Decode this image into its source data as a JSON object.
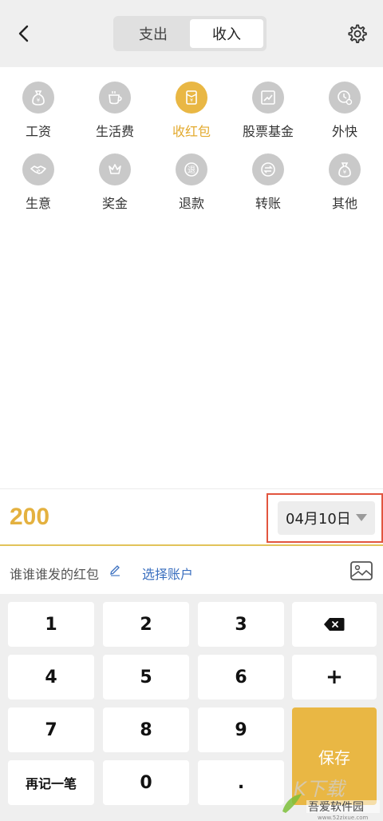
{
  "header": {
    "back_icon": "chevron-left-icon",
    "tabs": [
      {
        "label": "支出",
        "active": false
      },
      {
        "label": "收入",
        "active": true
      }
    ],
    "settings_icon": "gear-icon"
  },
  "categories": [
    {
      "label": "工资",
      "icon": "money-bag-icon",
      "active": false
    },
    {
      "label": "生活费",
      "icon": "cup-icon",
      "active": false
    },
    {
      "label": "收红包",
      "icon": "red-envelope-icon",
      "active": true
    },
    {
      "label": "股票基金",
      "icon": "stock-chart-icon",
      "active": false
    },
    {
      "label": "外快",
      "icon": "clock-coin-icon",
      "active": false
    },
    {
      "label": "生意",
      "icon": "handshake-icon",
      "active": false
    },
    {
      "label": "奖金",
      "icon": "crown-icon",
      "active": false
    },
    {
      "label": "退款",
      "icon": "refund-icon",
      "active": false
    },
    {
      "label": "转账",
      "icon": "transfer-icon",
      "active": false
    },
    {
      "label": "其他",
      "icon": "money-bag-icon",
      "active": false
    }
  ],
  "amount": {
    "value": "200",
    "date": "04月10日"
  },
  "note": {
    "text": "谁谁谁发的红包",
    "account_link": "选择账户"
  },
  "keypad": {
    "k1": "1",
    "k2": "2",
    "k3": "3",
    "k4": "4",
    "k5": "5",
    "k6": "6",
    "k7": "7",
    "k8": "8",
    "k9": "9",
    "k0": "0",
    "dot": ".",
    "plus": "+",
    "again": "再记一笔",
    "save": "保存",
    "delete_icon": "backspace-icon"
  },
  "watermark": {
    "brand": "吾爱软件园",
    "url": "www.52zixue.com"
  },
  "colors": {
    "accent": "#e9b744",
    "accent_text": "#e3aa2e",
    "highlight_box": "#e2553f",
    "link": "#3a6fbf",
    "icon_gray": "#c9c9c9"
  }
}
